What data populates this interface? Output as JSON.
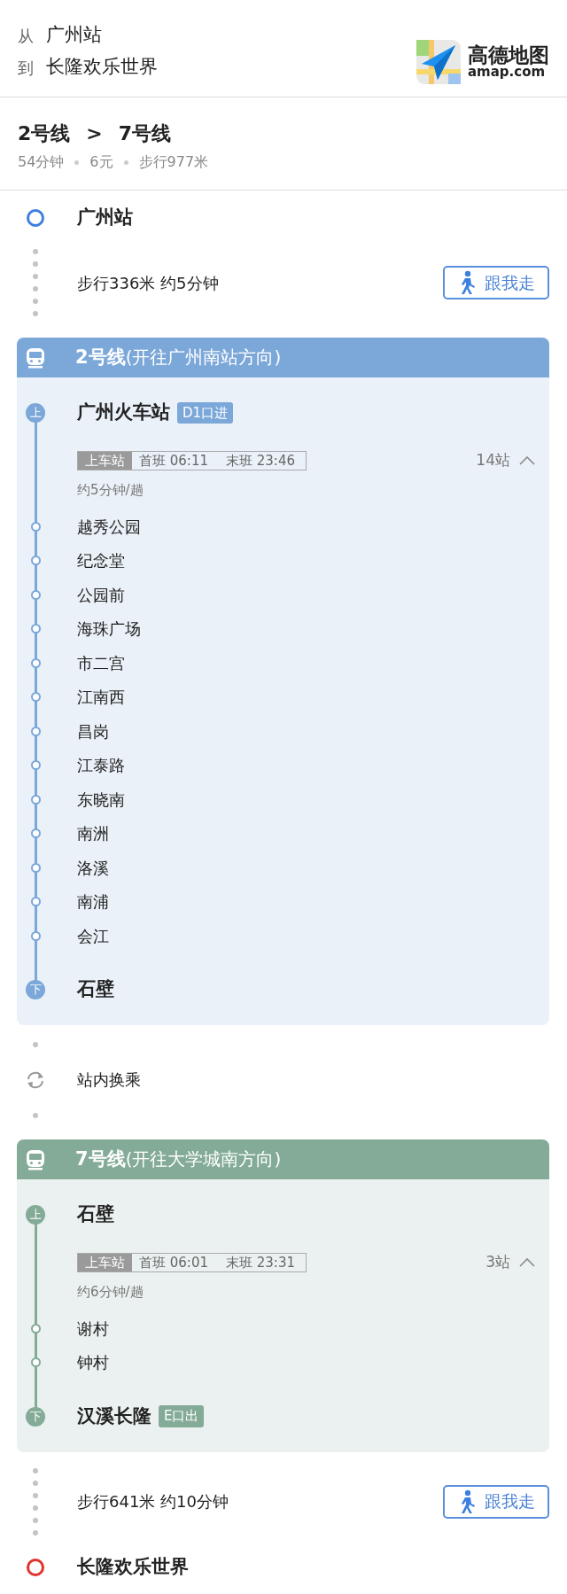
{
  "header": {
    "from_label": "从",
    "from": "广州站",
    "to_label": "到",
    "to": "长隆欢乐世界",
    "logo": {
      "name": "高德地图",
      "domain": "amap.com"
    }
  },
  "summary": {
    "lines": [
      "2号线",
      "7号线"
    ],
    "separator": ">",
    "meta": [
      "54分钟",
      "6元",
      "步行977米"
    ]
  },
  "steps": [
    {
      "kind": "origin",
      "name": "广州站"
    },
    {
      "kind": "walk",
      "text": "步行336米 约5分钟",
      "button": "跟我走"
    },
    {
      "kind": "line",
      "color": "#7ba7d9",
      "title": "2号线",
      "direction": "(开往广州南站方向)",
      "board": {
        "badge": "上",
        "name": "广州火车站",
        "exit": "D1口进"
      },
      "schedule": {
        "label": "上车站",
        "first": "首班 06:11",
        "last": "末班 23:46"
      },
      "frequency": "约5分钟/趟",
      "stop_count": "14站",
      "expanded": true,
      "stops": [
        "越秀公园",
        "纪念堂",
        "公园前",
        "海珠广场",
        "市二宫",
        "江南西",
        "昌岗",
        "江泰路",
        "东晓南",
        "南洲",
        "洛溪",
        "南浦",
        "会江"
      ],
      "alight": {
        "badge": "下",
        "name": "石壁"
      }
    },
    {
      "kind": "transfer",
      "text": "站内换乘"
    },
    {
      "kind": "line",
      "color": "#83ab97",
      "title": "7号线",
      "direction": "(开往大学城南方向)",
      "board": {
        "badge": "上",
        "name": "石壁"
      },
      "schedule": {
        "label": "上车站",
        "first": "首班 06:01",
        "last": "末班 23:31"
      },
      "frequency": "约6分钟/趟",
      "stop_count": "3站",
      "expanded": true,
      "stops": [
        "谢村",
        "钟村"
      ],
      "alight": {
        "badge": "下",
        "name": "汉溪长隆",
        "exit": "E口出"
      }
    },
    {
      "kind": "walk",
      "text": "步行641米 约10分钟",
      "button": "跟我走"
    },
    {
      "kind": "destination",
      "name": "长隆欢乐世界"
    }
  ]
}
